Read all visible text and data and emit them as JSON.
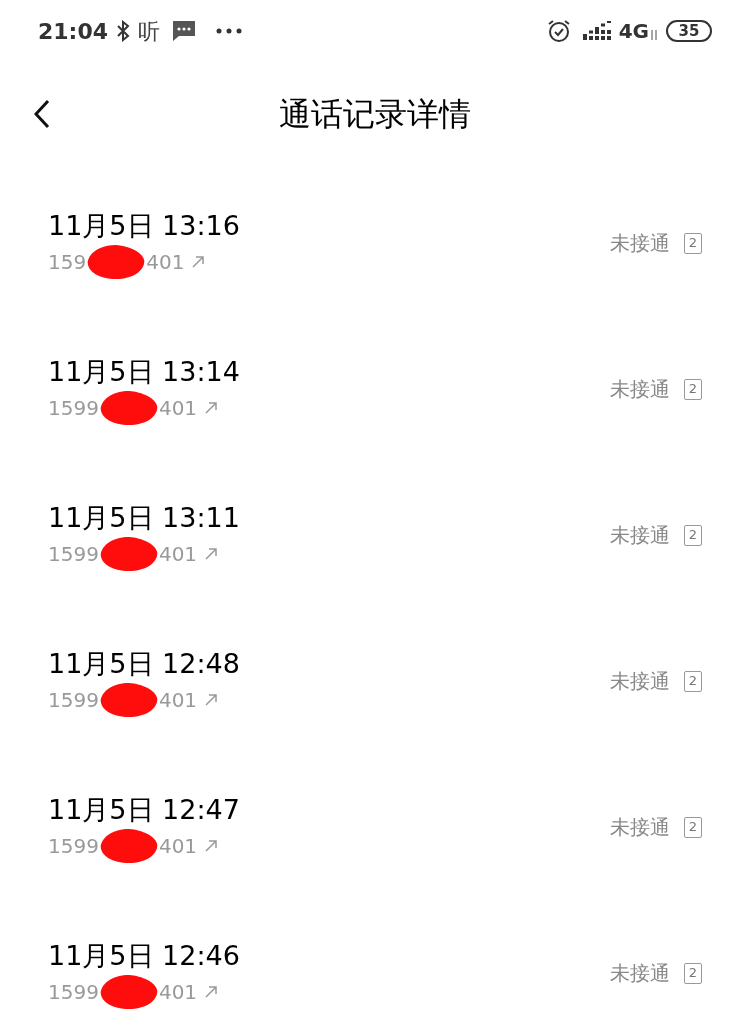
{
  "status_bar": {
    "time": "21:04",
    "listen_glyph": "听",
    "network": "4G",
    "battery": "35"
  },
  "header": {
    "title": "通话记录详情"
  },
  "calls": [
    {
      "datetime": "11月5日 13:16",
      "number_start": "159",
      "number_end": "401",
      "status": "未接通",
      "sim": "2"
    },
    {
      "datetime": "11月5日 13:14",
      "number_start": "1599",
      "number_end": "401",
      "status": "未接通",
      "sim": "2"
    },
    {
      "datetime": "11月5日 13:11",
      "number_start": "1599",
      "number_end": "401",
      "status": "未接通",
      "sim": "2"
    },
    {
      "datetime": "11月5日 12:48",
      "number_start": "1599",
      "number_end": "401",
      "status": "未接通",
      "sim": "2"
    },
    {
      "datetime": "11月5日 12:47",
      "number_start": "1599",
      "number_end": "401",
      "status": "未接通",
      "sim": "2"
    },
    {
      "datetime": "11月5日 12:46",
      "number_start": "1599",
      "number_end": "401",
      "status": "未接通",
      "sim": "2"
    }
  ]
}
